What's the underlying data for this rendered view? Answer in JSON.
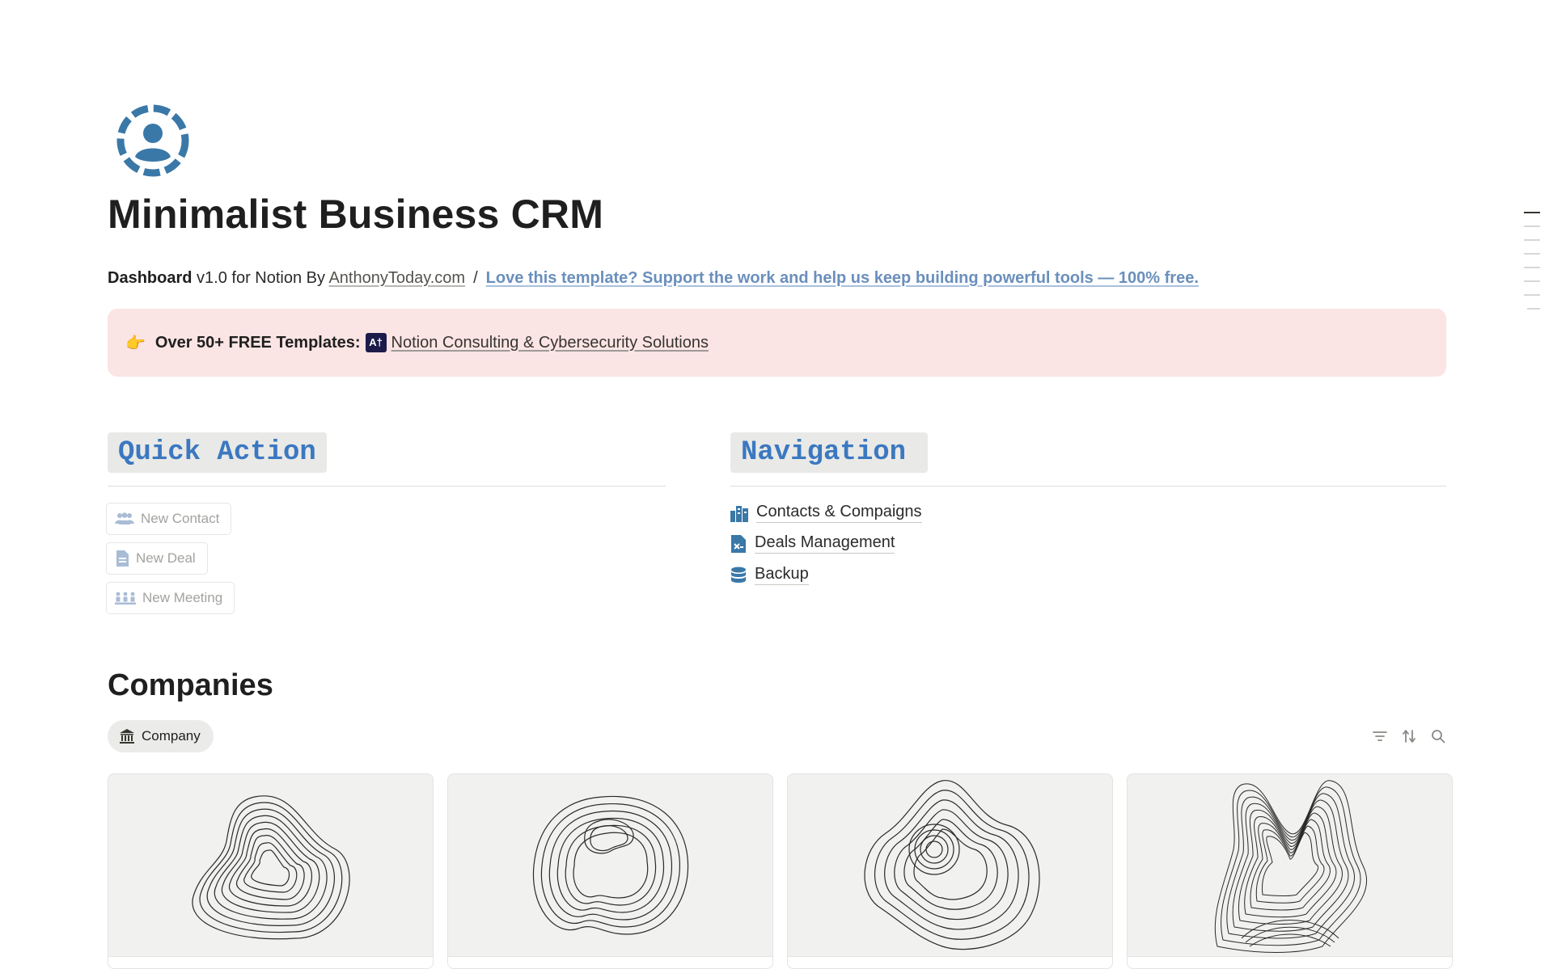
{
  "page": {
    "title": "Minimalist Business CRM",
    "icon": "user-circle-icon",
    "accent_color": "#3a78a8"
  },
  "subline": {
    "bold": "Dashboard",
    "text": " v1.0 for Notion By ",
    "author_link": "AnthonyToday.com",
    "separator": "/",
    "support_link": "Love this template? Support the work and help us keep building powerful tools — 100% free."
  },
  "callout": {
    "emoji": "👉",
    "bold": "Over 50+ FREE Templates:",
    "logo_text": "A†",
    "link": "Notion Consulting & Cybersecurity Solutions",
    "background": "#fbe4e4"
  },
  "quick_action": {
    "heading": "Quick Action",
    "buttons": [
      {
        "label": "New Contact",
        "icon": "people-icon"
      },
      {
        "label": "New Deal",
        "icon": "document-icon"
      },
      {
        "label": "New Meeting",
        "icon": "meeting-icon"
      }
    ]
  },
  "navigation": {
    "heading": "Navigation",
    "items": [
      {
        "label": "Contacts & Compaigns",
        "icon": "city-icon"
      },
      {
        "label": "Deals Management",
        "icon": "spreadsheet-icon"
      },
      {
        "label": "Backup",
        "icon": "database-icon"
      }
    ]
  },
  "companies": {
    "title": "Companies",
    "view_tab": "Company",
    "view_icon": "bank-icon",
    "toolbar": [
      "filter-icon",
      "sort-icon",
      "search-icon"
    ],
    "cards": [
      {
        "cover": "topographic-art-1"
      },
      {
        "cover": "topographic-art-2"
      },
      {
        "cover": "topographic-art-3"
      },
      {
        "cover": "topographic-art-4"
      }
    ]
  }
}
